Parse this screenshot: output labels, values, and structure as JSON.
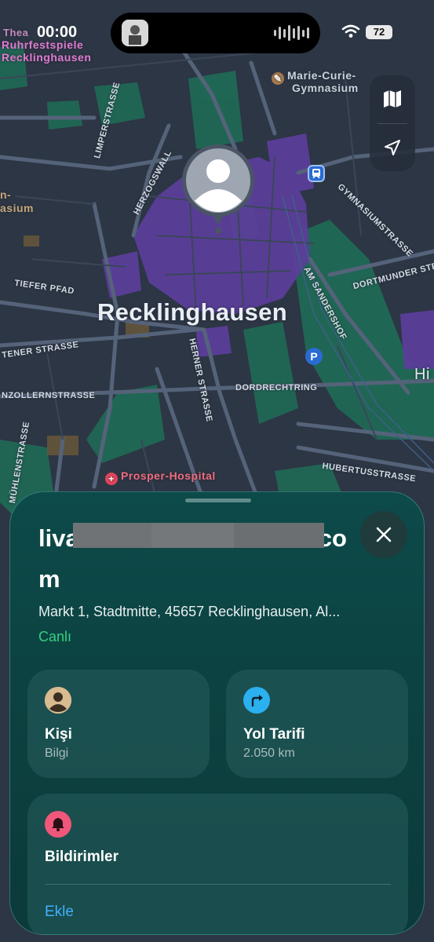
{
  "status_bar": {
    "time": "00:00",
    "battery": "72"
  },
  "map": {
    "city_label": "Recklinghausen",
    "streets": [
      "LIMPERSTRASSE",
      "HERZOGSWALL",
      "TIEFER PFAD",
      "TENER STRASSE",
      "NZOLLERNSTRASSE",
      "MÜHLENSTRASSE",
      "HERNER STRASSE",
      "DORDRECHTRING",
      "AM SANDERSHOF",
      "DORTMUNDER STRASSE",
      "GYMNASIUMSTRASSE",
      "HUBERTUSSTRASSE"
    ],
    "pois": {
      "top_left_line1": "Thea",
      "top_left_line2": "Ruhrfestspiele",
      "top_left_line3": "Recklinghausen",
      "school_line1": "Marie-Curie-",
      "school_line2": "Gymnasium",
      "left_line1": "n-",
      "left_line2": "asium",
      "hospital": "Prosper-Hospital",
      "right_edge": "Hi"
    },
    "controls": {
      "map_mode": "map-icon",
      "locate": "location-arrow-icon"
    }
  },
  "sheet": {
    "title": "liva                                  co m",
    "title_line1": "liva",
    "title_line1_end": "co",
    "title_line2": "m",
    "address": "Markt 1, Stadtmitte, 45657 Recklinghausen, Al...",
    "status": "Canlı",
    "cards": {
      "person": {
        "title": "Kişi",
        "subtitle": "Bilgi"
      },
      "directions": {
        "title": "Yol Tarifi",
        "subtitle": "2.050 km"
      }
    },
    "notifications": {
      "title": "Bildirimler",
      "action": "Ekle"
    }
  },
  "colors": {
    "sheet_bg": "#0c4241",
    "live_green": "#35d07f",
    "link_blue": "#3fb0ff",
    "district_purple": "#5b3e9a",
    "park_green": "#1f6b56"
  }
}
